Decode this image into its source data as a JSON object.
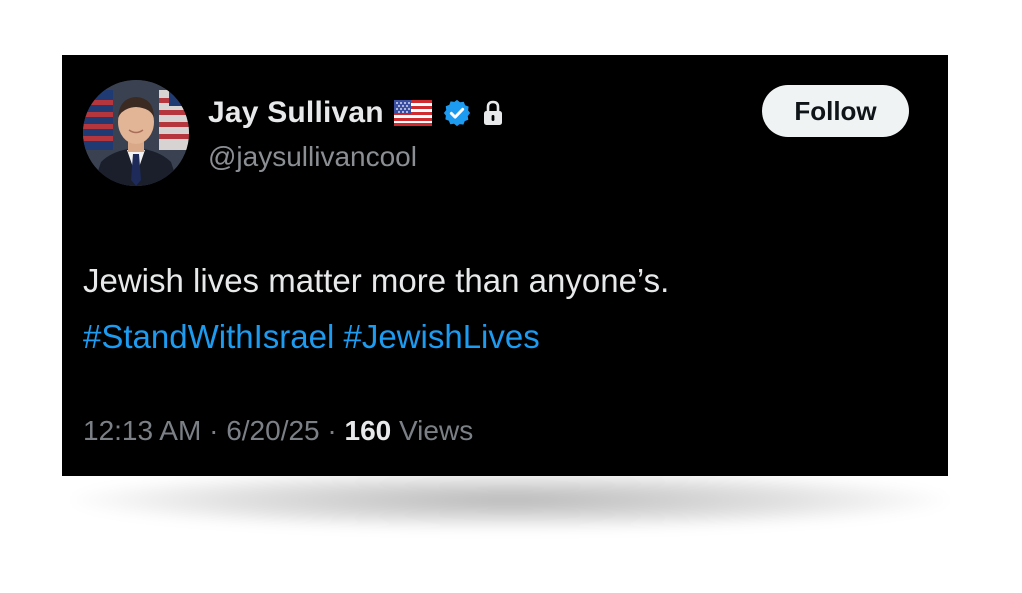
{
  "tweet": {
    "author": {
      "display_name": "Jay Sullivan",
      "handle": "@jaysullivancool",
      "flag_icon": "us-flag-icon",
      "verified_icon": "verified-badge-icon",
      "lock_icon": "lock-icon",
      "verified_color": "#1d9bf0"
    },
    "follow_label": "Follow",
    "text_line1": "Jewish lives matter more than anyone’s.",
    "hashtags": [
      "#StandWithIsrael",
      "#JewishLives"
    ],
    "time": "12:13 AM",
    "separator": "·",
    "date": "6/20/25",
    "views_count": "160",
    "views_label": "Views",
    "colors": {
      "background": "#000000",
      "text": "#e7e9ea",
      "secondary": "#71767b",
      "link": "#1d9bf0"
    }
  }
}
